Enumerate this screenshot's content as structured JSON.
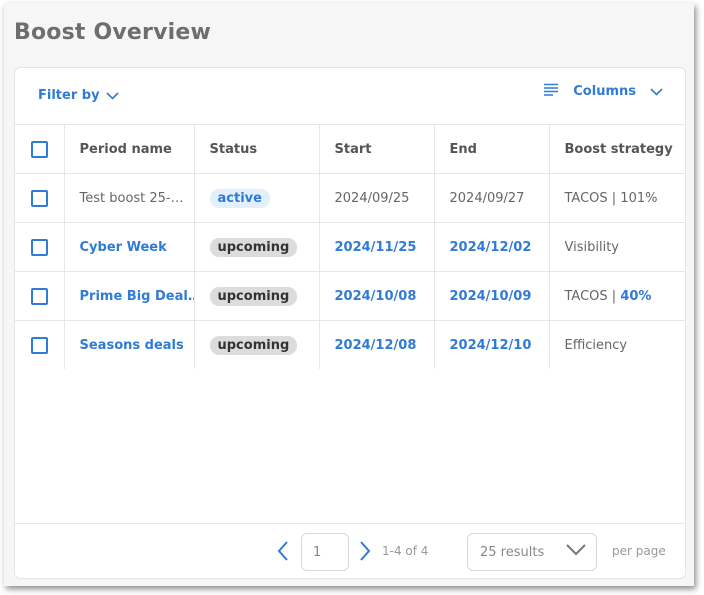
{
  "page": {
    "title": "Boost Overview"
  },
  "toolbar": {
    "filter_label": "Filter by",
    "columns_label": "Columns"
  },
  "table": {
    "headers": [
      "Period name",
      "Status",
      "Start",
      "End",
      "Boost strategy"
    ],
    "rows": [
      {
        "name": "Test boost 25-…",
        "status": "active",
        "start": "2024/09/25",
        "end": "2024/09/27",
        "strategy": "TACOS | 101%"
      },
      {
        "name": "Cyber Week",
        "status": "upcoming",
        "start": "2024/11/25",
        "end": "2024/12/02",
        "strategy": "Visibility"
      },
      {
        "name": "Prime Big Deal…",
        "status": "upcoming",
        "start": "2024/10/08",
        "end": "2024/10/09",
        "strategy_prefix": "TACOS | ",
        "strategy_value": "40%"
      },
      {
        "name": "Seasons deals",
        "status": "upcoming",
        "start": "2024/12/08",
        "end": "2024/12/10",
        "strategy": "Efficiency"
      }
    ]
  },
  "pagination": {
    "page": "1",
    "range": "1-4 of 4",
    "results_option": "25 results",
    "per_page_label": "per page"
  },
  "colors": {
    "accent": "#2f7bd6",
    "active_bg": "#e3f0fb",
    "upcoming_bg": "#dcdcdc"
  },
  "icons": [
    "chevron-down-icon",
    "columns-list-icon",
    "chevron-left-icon",
    "chevron-right-icon"
  ]
}
